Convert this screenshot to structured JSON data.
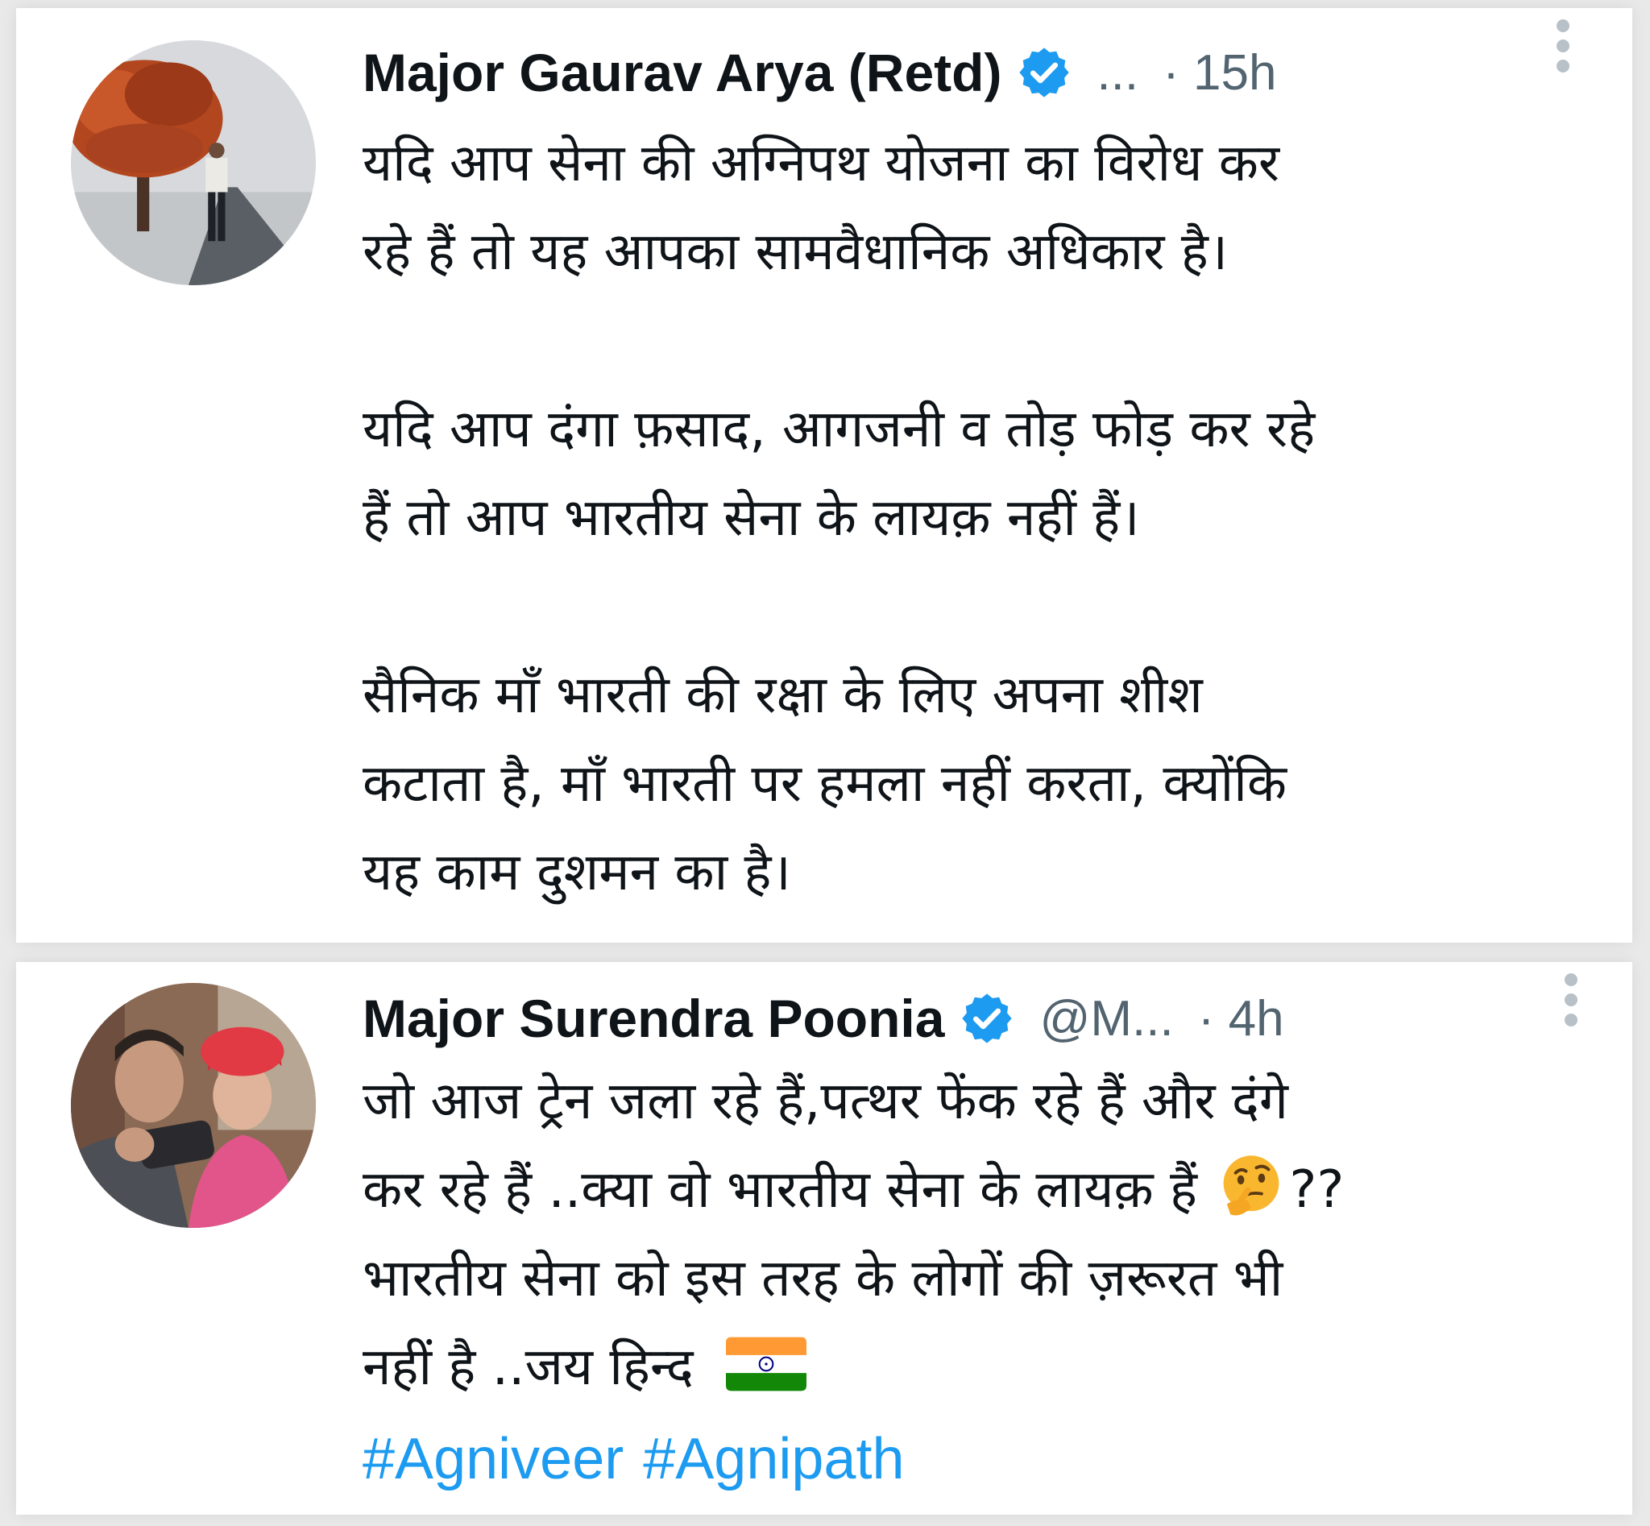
{
  "tweets": [
    {
      "author_name": "Major Gaurav Arya (Retd)",
      "verified": true,
      "handle": "...",
      "time": "· 15h",
      "paragraphs": [
        [
          "यदि आप सेना की अग्निपथ योजना का विरोध कर",
          "रहे हैं तो यह आपका सामवैधानिक अधिकार है।"
        ],
        [
          "यदि आप दंगा फ़साद, आगजनी व तोड़ फोड़ कर रहे",
          "हैं तो आप भारतीय सेना के लायक़ नहीं हैं।"
        ],
        [
          "सैनिक माँ भारती की रक्षा के लिए अपना शीश",
          "कटाता है, माँ भारती पर हमला नहीं करता, क्योंकि",
          "यह काम दुशमन का है।"
        ]
      ]
    },
    {
      "author_name": "Major Surendra Poonia",
      "verified": true,
      "handle": "@M...",
      "time": "· 4h",
      "lines": {
        "l1": "जो आज ट्रेन जला रहे हैं,पत्थर फेंक रहे हैं और दंगे",
        "l2": "कर रहे हैं ..क्या वो भारतीय सेना के लायक़ हैं",
        "l2_emoji": "thinking-face-emoji",
        "l2_tail": "??",
        "l3": "भारतीय सेना को इस तरह के लोगों की ज़रूरत भी",
        "l4": "नहीं है ..जय हिन्द",
        "l4_emoji": "india-flag-emoji"
      },
      "hashtags": [
        "#Agniveer",
        "#Agnipath"
      ]
    }
  ],
  "colors": {
    "verified_blue": "#1d9bf0",
    "hashtag_blue": "#1d9bf0",
    "meta_gray": "#536471"
  }
}
